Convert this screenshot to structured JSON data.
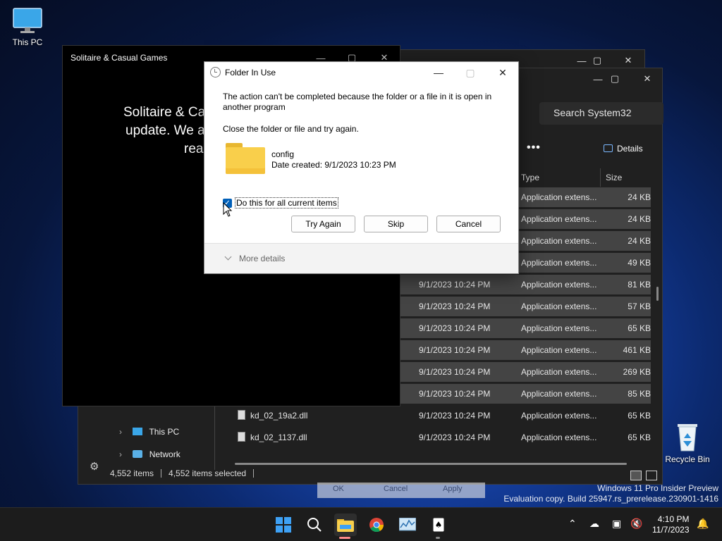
{
  "desktop": {
    "this_pc_label": "This PC",
    "recycle_bin_label": "Recycle Bin"
  },
  "explorer": {
    "search_placeholder": "Search System32",
    "more_label": "•••",
    "details_label": "Details",
    "columns": {
      "type": "Type",
      "size": "Size"
    },
    "rows": [
      {
        "name": "",
        "date": "",
        "type": "Application extens...",
        "size": "24 KB"
      },
      {
        "name": "",
        "date": "",
        "type": "Application extens...",
        "size": "24 KB"
      },
      {
        "name": "",
        "date": "",
        "type": "Application extens...",
        "size": "24 KB"
      },
      {
        "name": "",
        "date": "",
        "type": "Application extens...",
        "size": "49 KB"
      },
      {
        "name": "",
        "date": "9/1/2023 10:24 PM",
        "type": "Application extens...",
        "size": "81 KB"
      },
      {
        "name": "",
        "date": "9/1/2023 10:24 PM",
        "type": "Application extens...",
        "size": "57 KB"
      },
      {
        "name": "",
        "date": "9/1/2023 10:24 PM",
        "type": "Application extens...",
        "size": "65 KB"
      },
      {
        "name": "",
        "date": "9/1/2023 10:24 PM",
        "type": "Application extens...",
        "size": "461 KB"
      },
      {
        "name": "",
        "date": "9/1/2023 10:24 PM",
        "type": "Application extens...",
        "size": "269 KB"
      },
      {
        "name": "",
        "date": "9/1/2023 10:24 PM",
        "type": "Application extens...",
        "size": "85 KB"
      },
      {
        "name": "kd_02_19a2.dll",
        "date": "9/1/2023 10:24 PM",
        "type": "Application extens...",
        "size": "65 KB"
      },
      {
        "name": "kd_02_1137.dll",
        "date": "9/1/2023 10:24 PM",
        "type": "Application extens...",
        "size": "65 KB"
      }
    ],
    "nav": {
      "this_pc": "This PC",
      "network": "Network"
    },
    "status": {
      "items": "4,552 items",
      "selected": "4,552 items selected"
    }
  },
  "solitaire": {
    "title": "Solitaire & Casual Games",
    "lines": [
      "Solitaire & Ca",
      "update. We a",
      "rea"
    ]
  },
  "dialog": {
    "title": "Folder In Use",
    "message": "The action can't be completed because the folder or a file in it is open in another program",
    "instruction": "Close the folder or file and try again.",
    "file_name": "config",
    "file_date": "Date created: 9/1/2023 10:23 PM",
    "checkbox_label": "Do this for all current items",
    "buttons": {
      "try_again": "Try Again",
      "skip": "Skip",
      "cancel": "Cancel"
    },
    "more_details": "More details"
  },
  "ghost_buttons": {
    "ok": "OK",
    "cancel": "Cancel",
    "apply": "Apply"
  },
  "watermark": {
    "line1": "Windows 11 Pro Insider Preview",
    "line2": "Evaluation copy. Build 25947.rs_prerelease.230901-1416"
  },
  "taskbar": {
    "time": "4:10 PM",
    "date": "11/7/2023"
  },
  "colors": {
    "accent": "#005fb8",
    "dark_surface": "#202020",
    "selected_row": "#444444"
  }
}
